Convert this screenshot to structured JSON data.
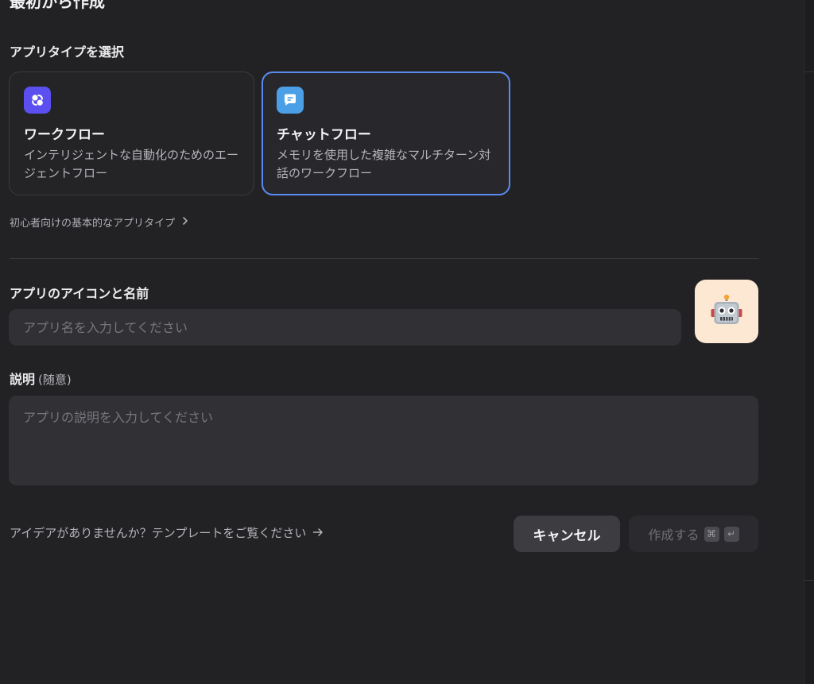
{
  "page": {
    "title": "最初から作成"
  },
  "app_type": {
    "label": "アプリタイプを選択",
    "cards": [
      {
        "title": "ワークフロー",
        "description": "インテリジェントな自動化のためのエージェントフロー",
        "icon": "workflow-icon",
        "icon_color": "#5b4ff0",
        "selected": false
      },
      {
        "title": "チャットフロー",
        "description": "メモリを使用した複雑なマルチターン対話のワークフロー",
        "icon": "chat-bubble-icon",
        "icon_color": "#4a9fe6",
        "selected": true
      }
    ],
    "beginner_link": "初心者向けの基本的なアプリタイプ"
  },
  "app_icon_name": {
    "label": "アプリのアイコンと名前",
    "name_placeholder": "アプリ名を入力してください",
    "name_value": "",
    "icon": "robot-emoji",
    "icon_bg": "#fde8d4"
  },
  "description": {
    "label": "説明",
    "optional": "(随意)",
    "placeholder": "アプリの説明を入力してください",
    "value": ""
  },
  "footer": {
    "template_link": "アイデアがありませんか？テンプレートをご覧ください",
    "cancel_label": "キャンセル",
    "create_label": "作成する",
    "create_shortcut_1": "⌘",
    "create_shortcut_2": "↵"
  },
  "colors": {
    "accent": "#5b8bf0",
    "background": "#222225"
  }
}
